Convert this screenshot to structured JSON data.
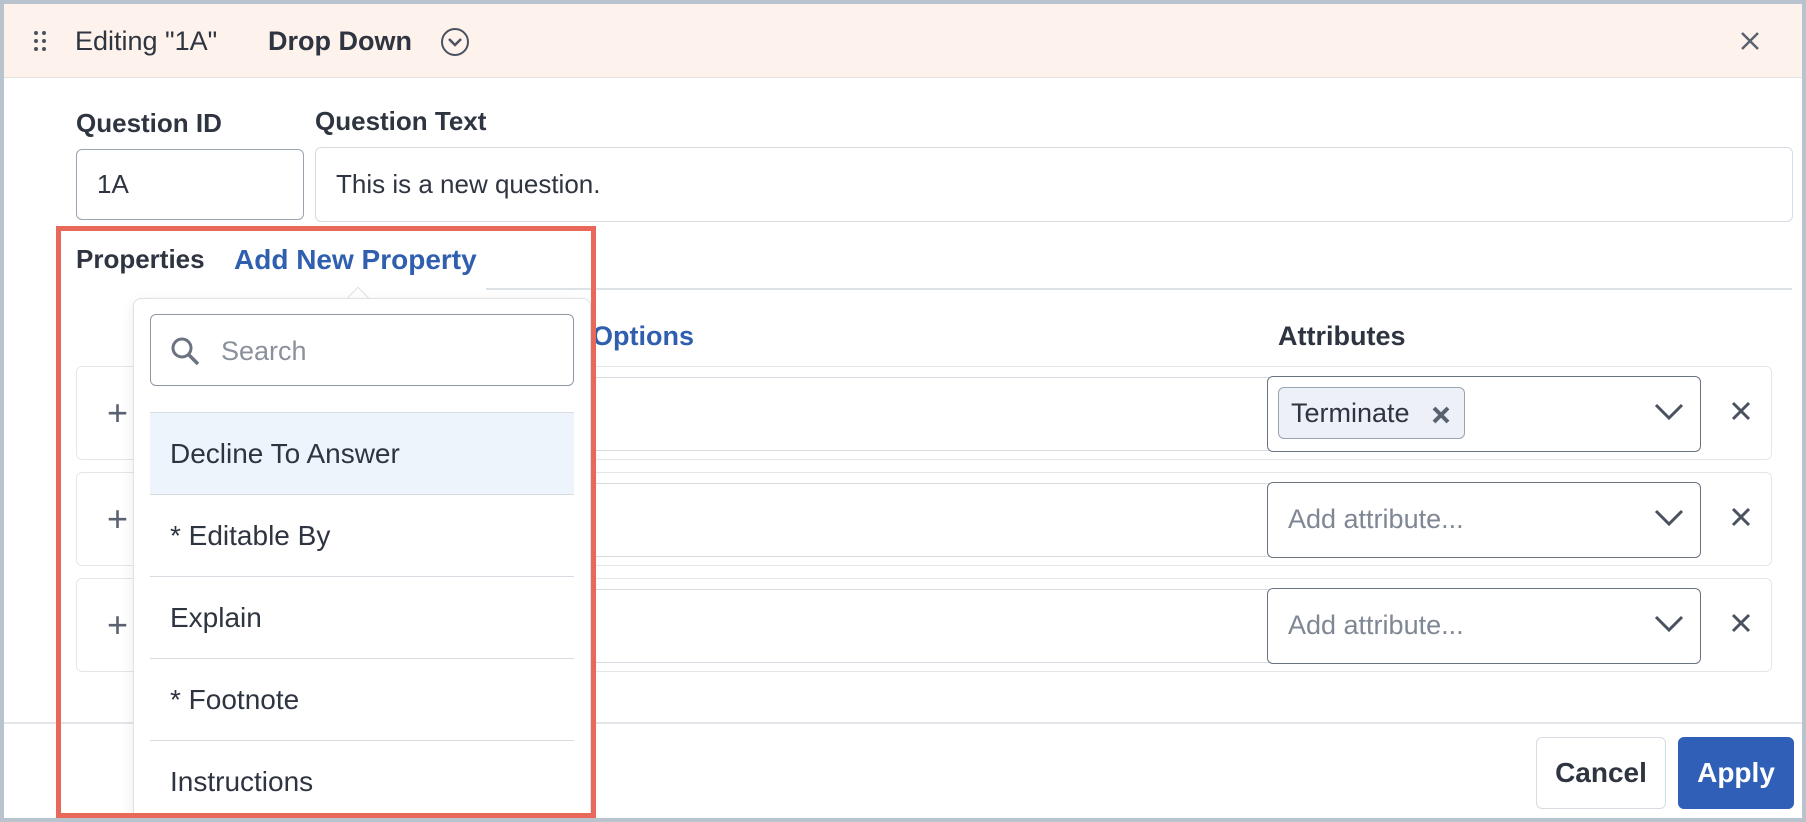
{
  "header": {
    "title": "Editing \"1A\"",
    "type_label": "Drop Down"
  },
  "form": {
    "question_id_label": "Question ID",
    "question_id_value": "1A",
    "question_text_label": "Question Text",
    "question_text_value": "This is a new question."
  },
  "properties": {
    "label": "Properties",
    "add_link": "Add New Property"
  },
  "table": {
    "options_header": "Options",
    "attributes_header": "Attributes",
    "rows": [
      {
        "attribute_tag": "Terminate",
        "attribute_placeholder": ""
      },
      {
        "attribute_tag": "",
        "attribute_placeholder": "Add attribute..."
      },
      {
        "attribute_tag": "",
        "attribute_placeholder": "Add attribute..."
      }
    ]
  },
  "dropdown": {
    "search_placeholder": "Search",
    "options": [
      "Decline To Answer",
      "* Editable By",
      "Explain",
      "* Footnote",
      "Instructions"
    ],
    "highlighted_index": 0
  },
  "footer": {
    "cancel_label": "Cancel",
    "apply_label": "Apply"
  },
  "colors": {
    "accent": "#2f5fb6",
    "link": "#2f5fae",
    "header_bg": "#fdf3ec",
    "annotation": "#e8695a"
  }
}
